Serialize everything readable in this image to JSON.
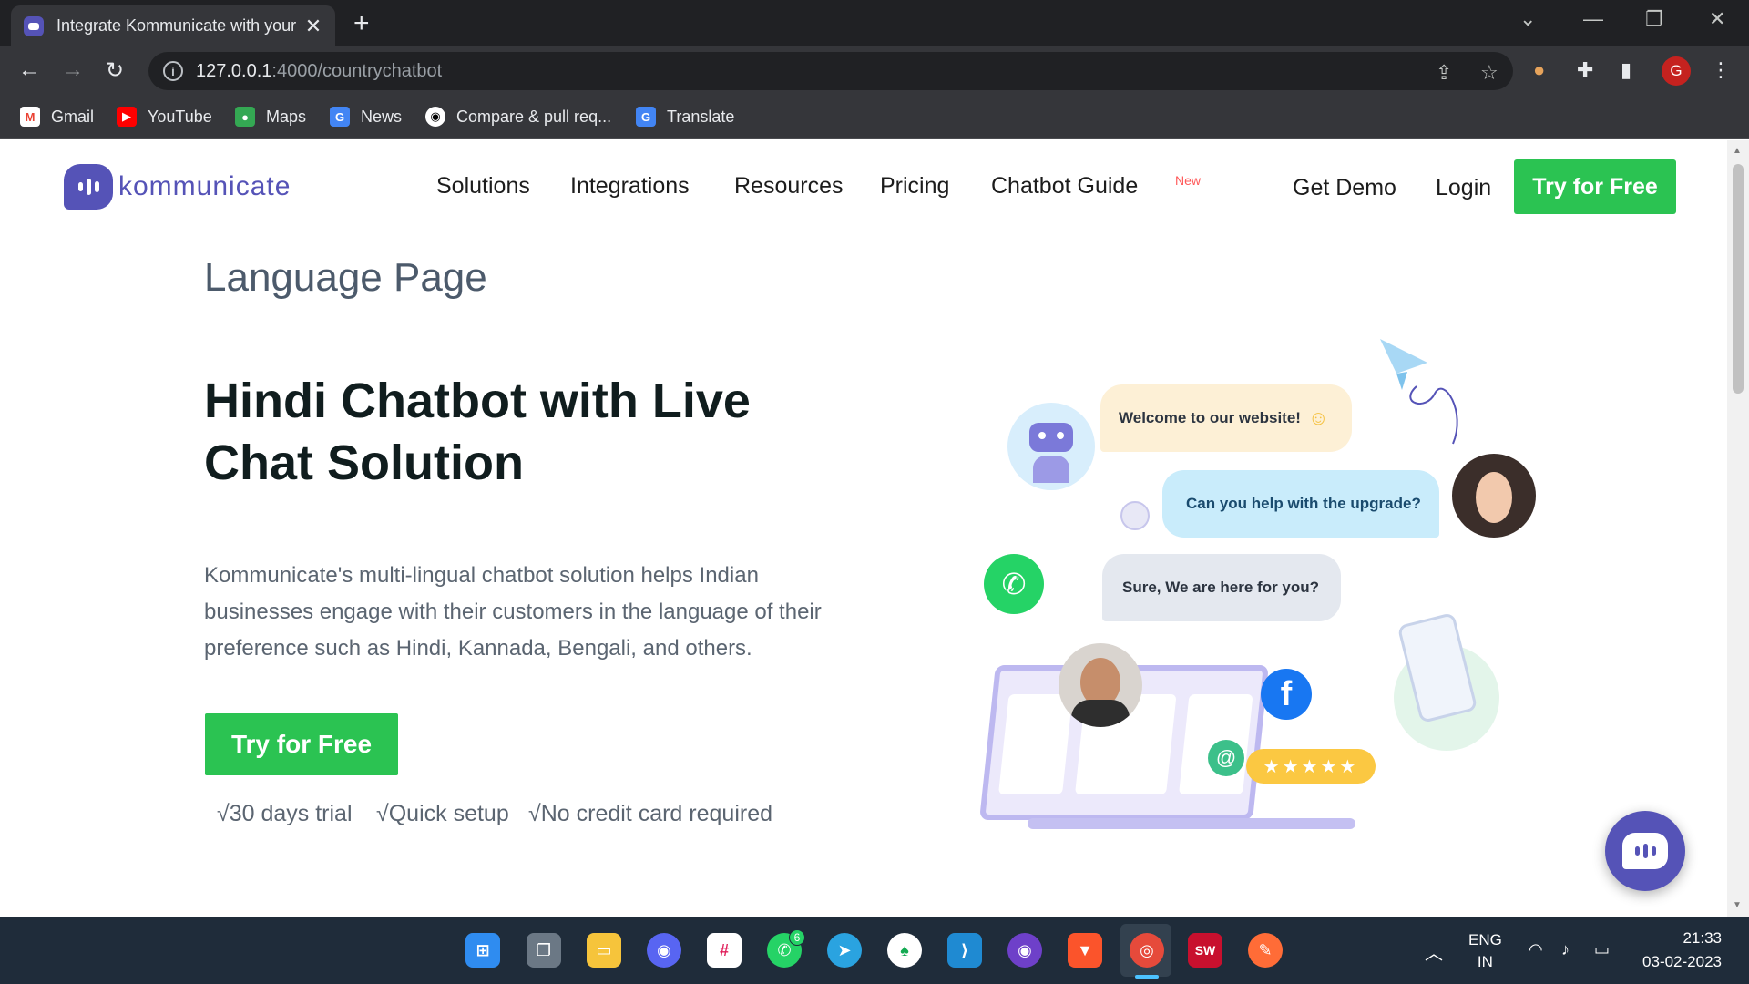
{
  "browser": {
    "tab_title": "Integrate Kommunicate with your",
    "tab_close": "✕",
    "new_tab": "+",
    "url_host": "127.0.0.1",
    "url_path": ":4000/countrychatbot",
    "profile_initial": "G"
  },
  "bookmarks": [
    {
      "label": "Gmail",
      "icon": "gmail-icon"
    },
    {
      "label": "YouTube",
      "icon": "youtube-icon"
    },
    {
      "label": "Maps",
      "icon": "maps-icon"
    },
    {
      "label": "News",
      "icon": "news-icon"
    },
    {
      "label": "Compare & pull req...",
      "icon": "github-icon"
    },
    {
      "label": "Translate",
      "icon": "translate-icon"
    }
  ],
  "site": {
    "logo_text": "kommunicate",
    "nav": [
      "Solutions",
      "Integrations",
      "Resources",
      "Pricing",
      "Chatbot Guide"
    ],
    "nav_badge": "New",
    "get_demo": "Get Demo",
    "login": "Login",
    "try_top": "Try for Free"
  },
  "main": {
    "page_label": "Language Page",
    "title": "Hindi Chatbot with Live Chat Solution",
    "description": "Kommunicate's multi-lingual chatbot solution helps Indian businesses engage with their customers in the language of their preference such as Hindi, Kannada, Bengali, and others.",
    "cta": "Try for Free",
    "features": [
      "√30 days trial",
      "√Quick setup",
      "√No credit card required"
    ]
  },
  "illustration": {
    "msg1": "Welcome to our website!",
    "msg2": "Can you help with the upgrade?",
    "msg3": "Sure, We are here for you?",
    "stars": "★★★★★"
  },
  "taskbar": {
    "lang_top": "ENG",
    "lang_bottom": "IN",
    "time": "21:33",
    "date": "03-02-2023",
    "whatsapp_badge": "6"
  }
}
